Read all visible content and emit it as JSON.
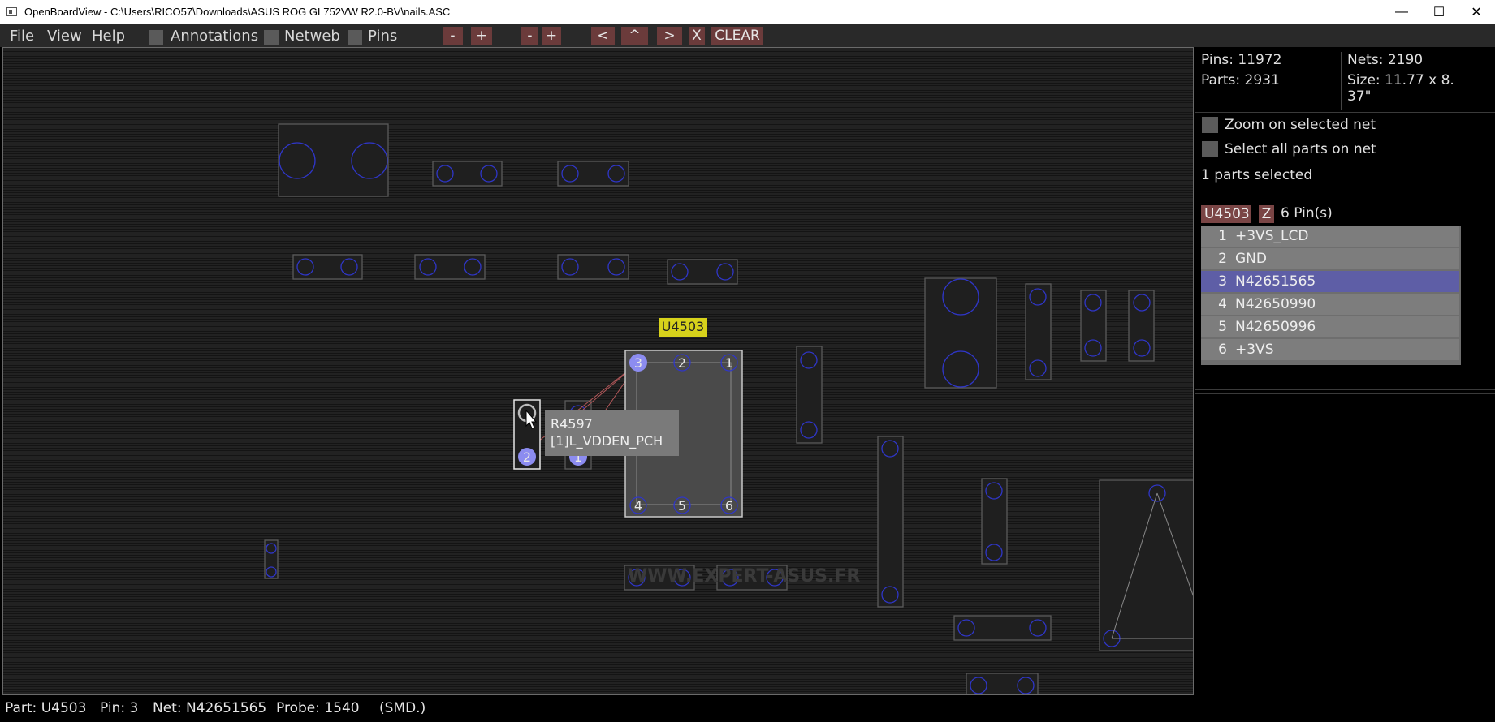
{
  "window": {
    "title": "OpenBoardView - C:\\Users\\RICO57\\Downloads\\ASUS ROG GL752VW R2.0-BV\\nails.ASC",
    "minimize": "—",
    "maximize": "☐",
    "close": "✕"
  },
  "menu": {
    "file": "File",
    "view": "View",
    "help": "Help"
  },
  "toggles": {
    "annotations": "Annotations",
    "netweb": "Netweb",
    "pins": "Pins"
  },
  "toolbar": {
    "zoom_out": "-",
    "zoom_in": "+",
    "zoom_out2": "-",
    "zoom_in2": "+",
    "left": "<",
    "up": "^",
    "right": ">",
    "close": "X",
    "clear": "CLEAR"
  },
  "board": {
    "part_label": "U4503",
    "chip_pins": [
      "3",
      "2",
      "1",
      "4",
      "5",
      "6"
    ],
    "probe_pins": [
      "2",
      "1"
    ],
    "tooltip": {
      "part": "R4597",
      "net": "[1]L_VDDEN_PCH"
    },
    "watermark": "WWW.EXPERT-ASUS.FR"
  },
  "info": {
    "pins": "Pins: 11972",
    "parts": "Parts: 2931",
    "nets": "Nets: 2190",
    "size_line1": "Size: 11.77 x 8.",
    "size_line2": "37\"",
    "zoom_on_net": "Zoom on selected net",
    "select_all_parts": "Select all parts on net",
    "parts_selected": "1 parts selected",
    "part_name": "U4503",
    "z_button": "Z",
    "pin_count": "6 Pin(s)",
    "pin_rows": [
      {
        "num": "1",
        "net": "+3VS_LCD"
      },
      {
        "num": "2",
        "net": "GND"
      },
      {
        "num": "3",
        "net": "N42651565"
      },
      {
        "num": "4",
        "net": "N42650990"
      },
      {
        "num": "5",
        "net": "N42650996"
      },
      {
        "num": "6",
        "net": "+3VS"
      }
    ]
  },
  "status": {
    "part": "Part: U4503",
    "pin": "Pin: 3",
    "net": "Net: N42651565",
    "probe": "Probe: 1540",
    "type": "(SMD.)"
  },
  "colors": {
    "pin_outline": "#2f36c8",
    "selected_pin": "#8c8cf0",
    "part_label_bg": "#d7d21b",
    "selected_row": "#5e5ea6"
  }
}
